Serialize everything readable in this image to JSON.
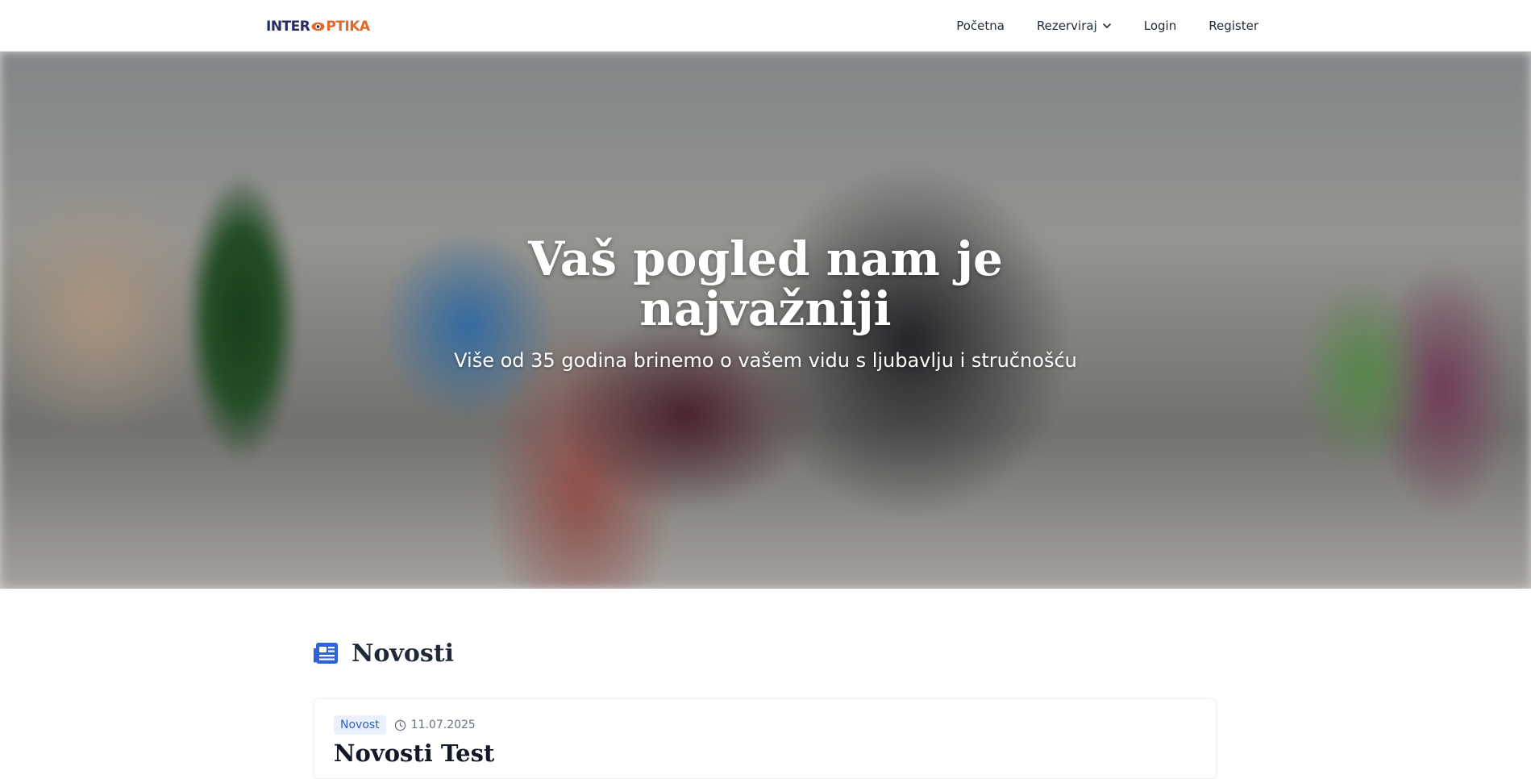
{
  "brand": {
    "logo_part1": "INTER",
    "logo_part2": "PTIKA",
    "logo_eye_icon": "eye-o-icon",
    "colors": {
      "navy": "#262b63",
      "orange": "#e0682b"
    }
  },
  "nav": {
    "items": [
      {
        "label": "Početna"
      },
      {
        "label": "Rezerviraj",
        "icon": "chevron-down-icon"
      },
      {
        "label": "Login"
      },
      {
        "label": "Register"
      }
    ]
  },
  "hero": {
    "title_line1": "Vaš pogled nam je",
    "title_line2": "najvažniji",
    "subtitle": "Više od 35 godina brinemo o vašem vidu s ljubavlju i stručnošću"
  },
  "news": {
    "heading": "Novosti",
    "heading_icon": "newspaper-icon",
    "accent_color": "#2f64d8",
    "items": [
      {
        "category": "Novost",
        "date": "11.07.2025",
        "title": "Novosti Test"
      }
    ]
  }
}
